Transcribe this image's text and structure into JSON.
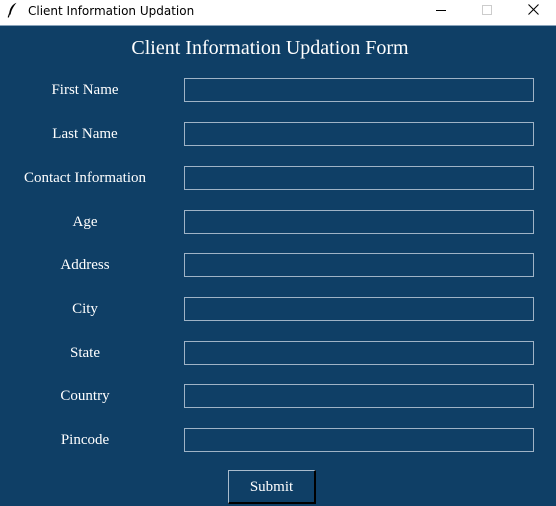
{
  "window": {
    "title": "Client Information Updation",
    "icon": "feather-icon",
    "controls": [
      "minimize-icon",
      "maximize-icon",
      "close-icon"
    ]
  },
  "form": {
    "heading": "Client Information Updation Form",
    "background": "#0f3f66",
    "fields": [
      {
        "label": "First Name",
        "value": ""
      },
      {
        "label": "Last Name",
        "value": ""
      },
      {
        "label": "Contact Information",
        "value": ""
      },
      {
        "label": "Age",
        "value": ""
      },
      {
        "label": "Address",
        "value": ""
      },
      {
        "label": "City",
        "value": ""
      },
      {
        "label": "State",
        "value": ""
      },
      {
        "label": "Country",
        "value": ""
      },
      {
        "label": "Pincode",
        "value": ""
      }
    ],
    "submit_label": "Submit"
  }
}
